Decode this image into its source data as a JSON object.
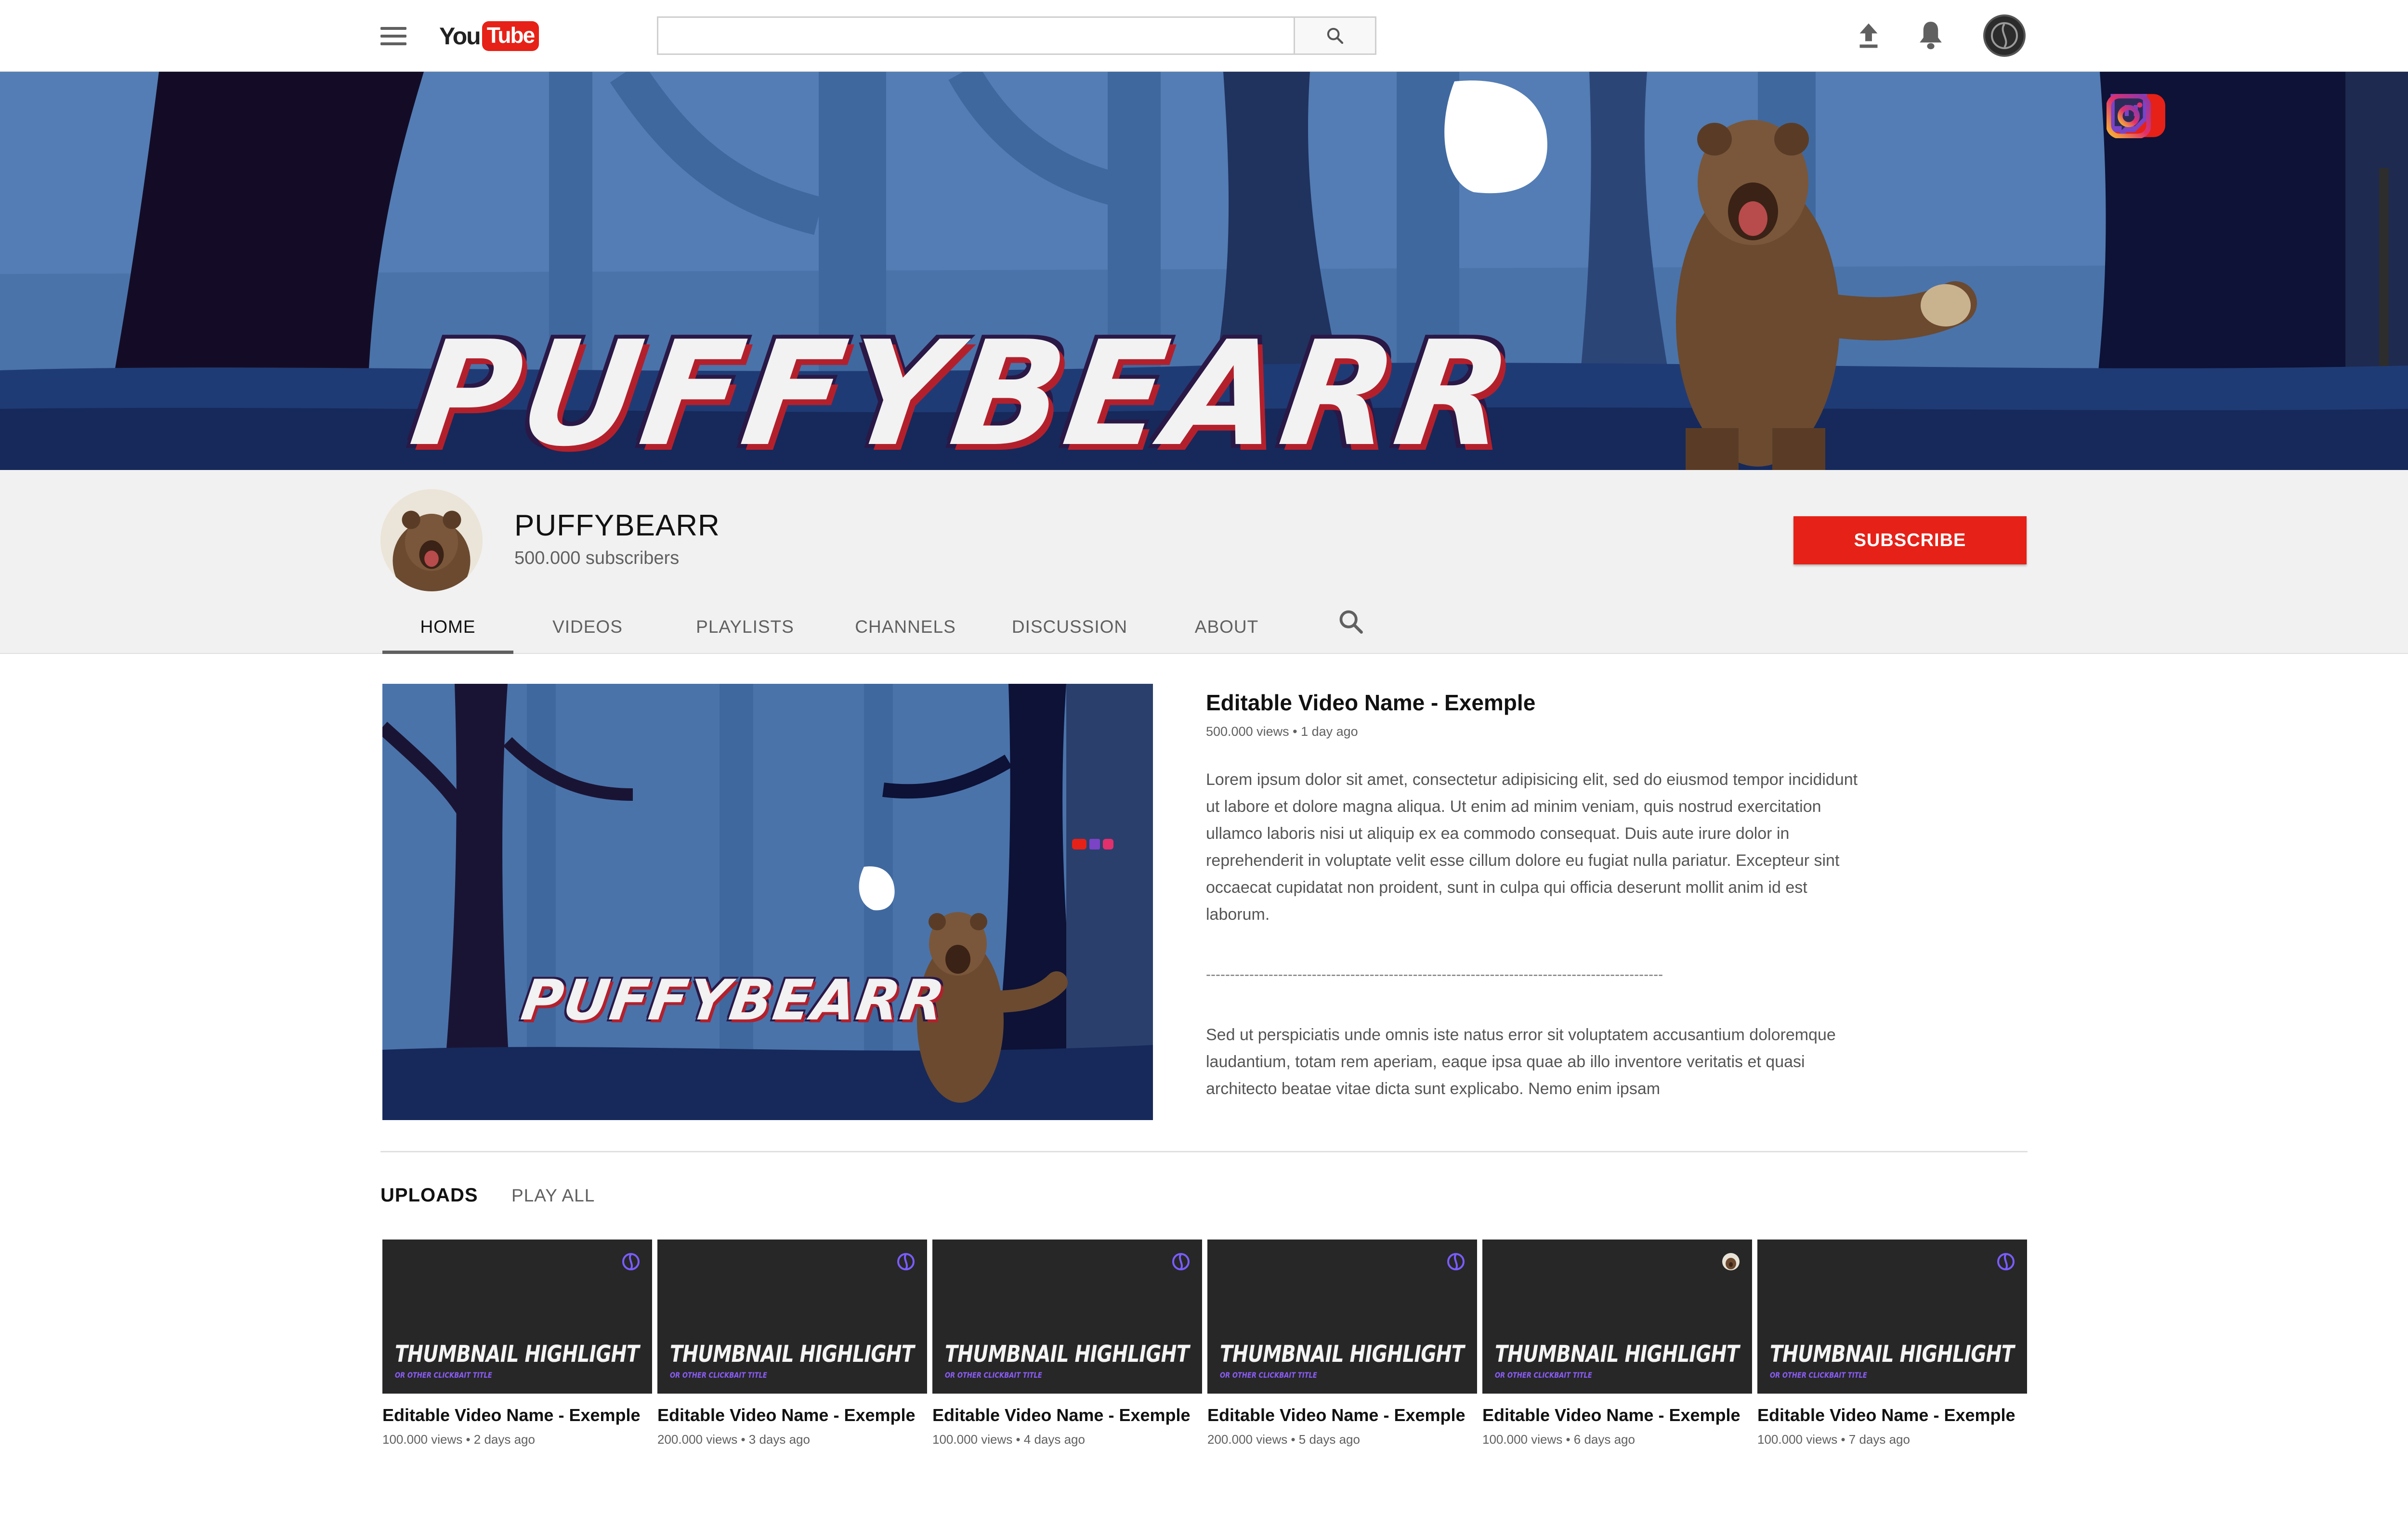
{
  "header": {
    "logo_you": "You",
    "logo_tube": "Tube",
    "search_placeholder": ""
  },
  "banner": {
    "title": "PUFFYBEARR",
    "socials": [
      "youtube-icon",
      "twitch-icon",
      "instagram-icon"
    ]
  },
  "channel": {
    "name": "PUFFYBEARR",
    "subscribers": "500.000 subscribers",
    "subscribe_label": "SUBSCRIBE",
    "tabs": [
      {
        "label": "HOME",
        "active": true
      },
      {
        "label": "VIDEOS",
        "active": false
      },
      {
        "label": "PLAYLISTS",
        "active": false
      },
      {
        "label": "CHANNELS",
        "active": false
      },
      {
        "label": "DISCUSSION",
        "active": false
      },
      {
        "label": "ABOUT",
        "active": false
      }
    ]
  },
  "featured": {
    "thumb_title": "PUFFYBEARR",
    "title": "Editable Video Name - Exemple",
    "meta": "500.000 views • 1 day ago",
    "description_1": "Lorem ipsum dolor sit amet, consectetur adipisicing elit, sed do eiusmod tempor incididunt ut labore et dolore magna aliqua. Ut enim ad minim veniam, quis nostrud exercitation ullamco laboris nisi ut aliquip ex ea commodo consequat. Duis aute irure dolor in reprehenderit in voluptate velit esse cillum dolore eu fugiat nulla pariatur. Excepteur sint occaecat cupidatat non proident, sunt in culpa qui officia deserunt mollit anim id est laborum.",
    "divider": "-----------------------------------------------------------------------------------------------",
    "description_2": "Sed ut perspiciatis unde omnis iste natus error sit voluptatem accusantium doloremque laudantium, totam rem aperiam, eaque ipsa quae ab illo inventore veritatis et quasi architecto beatae vitae dicta sunt explicabo. Nemo enim ipsam"
  },
  "uploads": {
    "label": "UPLOADS",
    "play_all": "PLAY ALL",
    "videos": [
      {
        "headline": "THUMBNAIL HIGHLIGHT",
        "sub": "OR OTHER CLICKBAIT TITLE",
        "title": "Editable Video Name - Exemple",
        "meta": "100.000 views • 2 days ago"
      },
      {
        "headline": "THUMBNAIL HIGHLIGHT",
        "sub": "OR OTHER CLICKBAIT TITLE",
        "title": "Editable Video Name - Exemple",
        "meta": "200.000 views • 3 days ago"
      },
      {
        "headline": "THUMBNAIL HIGHLIGHT",
        "sub": "OR OTHER CLICKBAIT TITLE",
        "title": "Editable Video Name - Exemple",
        "meta": "100.000 views • 4 days ago"
      },
      {
        "headline": "THUMBNAIL HIGHLIGHT",
        "sub": "OR OTHER CLICKBAIT TITLE",
        "title": "Editable Video Name - Exemple",
        "meta": "200.000 views • 5 days ago"
      },
      {
        "headline": "THUMBNAIL HIGHLIGHT",
        "sub": "OR OTHER CLICKBAIT TITLE",
        "title": "Editable Video Name - Exemple",
        "meta": "100.000 views • 6 days ago"
      },
      {
        "headline": "THUMBNAIL HIGHLIGHT",
        "sub": "OR OTHER CLICKBAIT TITLE",
        "title": "Editable Video Name - Exemple",
        "meta": "100.000 views • 7 days ago"
      }
    ]
  },
  "colors": {
    "brand_red": "#e62117",
    "banner_blue": "#3a5f94",
    "accent_purple": "#8a5cf6"
  }
}
